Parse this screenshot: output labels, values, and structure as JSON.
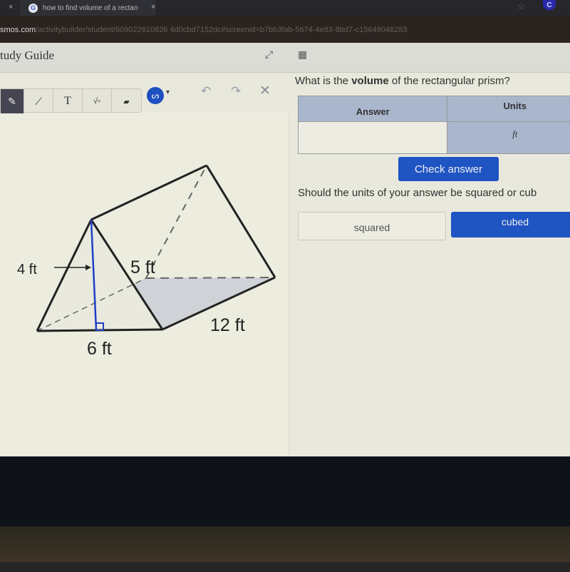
{
  "browser": {
    "tabs": [
      {
        "label": "how to find volume of a rectan",
        "icon": "google-icon",
        "active": true
      },
      {
        "label": "",
        "active": false
      }
    ],
    "tab_close_glyph": "×",
    "url_host": "smos.com",
    "url_path": "/activitybuilder/student/609022610826 4d0cbd7152dc#screenid=b7bb3fab-5674-4e83-8bd7-c15649046283",
    "profile_initial": "C"
  },
  "header": {
    "title": "tudy Guide",
    "fullscreen_icon": "expand-icon",
    "calculator_icon": "calculator-icon"
  },
  "toolbar": {
    "tools": [
      {
        "name": "pencil",
        "glyph": "✎",
        "selected": true
      },
      {
        "name": "line",
        "glyph": "⟋",
        "selected": false
      },
      {
        "name": "text",
        "glyph": "T",
        "selected": false
      },
      {
        "name": "math",
        "glyph": "√▫",
        "selected": false
      },
      {
        "name": "eraser",
        "glyph": "▰",
        "selected": false
      }
    ],
    "color_glyph": "ᔕ",
    "color": "#1d4fbf",
    "caret_glyph": "▾",
    "undo_glyph": "↶",
    "redo_glyph": "↷",
    "clear_glyph": "✕"
  },
  "figure": {
    "labels": {
      "height": "4 ft",
      "slant": "5 ft",
      "base": "6 ft",
      "length": "12 ft"
    }
  },
  "question1": {
    "prefix": "What is the ",
    "bold": "volume",
    "suffix": " of the rectangular prism?",
    "table": {
      "headers": [
        "Answer",
        "Units"
      ],
      "answer_value": "",
      "units_value": "ft"
    },
    "check_button": "Check answer"
  },
  "question2": {
    "text": "Should the units of your answer be squared or cub",
    "options": [
      {
        "label": "squared",
        "selected": false
      },
      {
        "label": "cubed",
        "selected": true
      }
    ]
  },
  "colors": {
    "accent": "#1f54c3",
    "table_header": "#a9b6cc",
    "height_line": "#1e3ec8"
  }
}
